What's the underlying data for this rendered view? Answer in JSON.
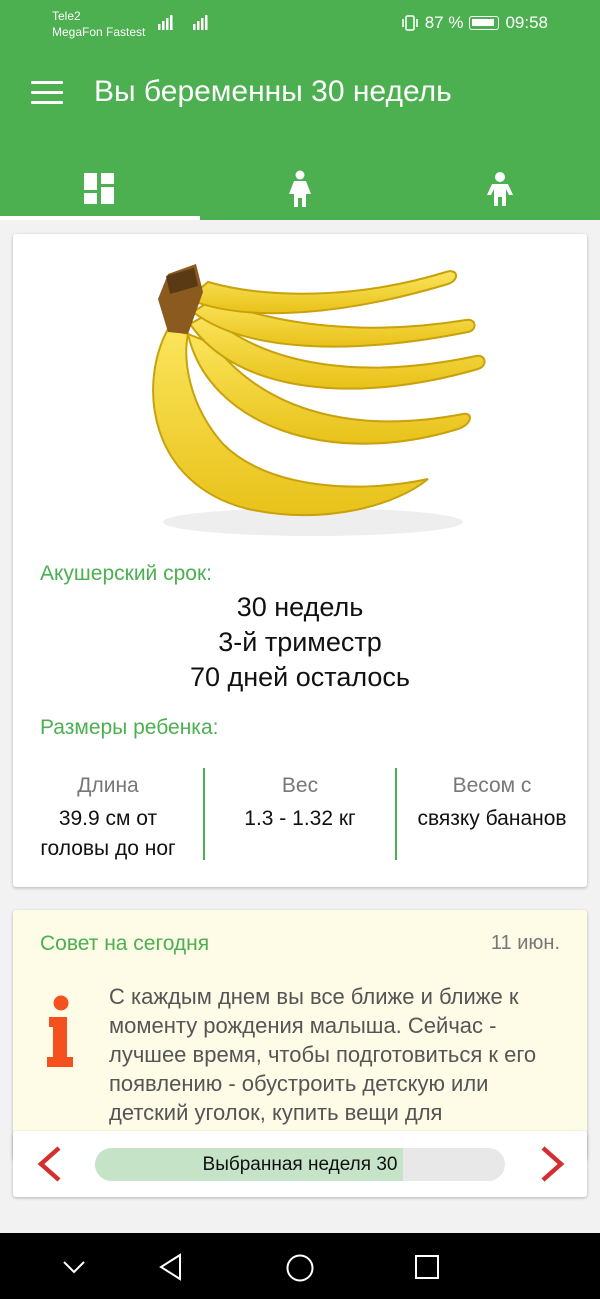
{
  "status_bar": {
    "carrier_1": "Tele2",
    "carrier_2": "MegaFon Fastest",
    "battery": "87 %",
    "time": "09:58"
  },
  "app_bar": {
    "title": "Вы беременны 30 недель",
    "menu_icon": "menu-icon",
    "tabs": [
      {
        "icon": "dashboard-icon",
        "active": true
      },
      {
        "icon": "woman-icon",
        "active": false
      },
      {
        "icon": "child-icon",
        "active": false
      }
    ]
  },
  "info": {
    "image": "banana-bunch",
    "term_label": "Акушерский срок:",
    "term_lines": [
      "30 недель",
      "3-й триместр",
      "70 дней осталось"
    ],
    "size_label": "Размеры ребенка:",
    "sizes": [
      {
        "head": "Длина",
        "value": "39.9 см от головы до ног"
      },
      {
        "head": "Вес",
        "value": "1.3 - 1.32 кг"
      },
      {
        "head": "Весом с",
        "value": "связку бананов"
      }
    ]
  },
  "tip": {
    "title": "Совет на сегодня",
    "date": "11 июн.",
    "text": "С каждым днем вы все ближе и ближе к моменту рождения малыша. Сейчас - лучшее время, чтобы подготовиться к его появлению - обустроить детскую или детский уголок, купить вещи для"
  },
  "week_selector": {
    "label": "Выбранная неделя 30",
    "progress": 0.75
  },
  "colors": {
    "primary": "#4caf50",
    "tip_background": "#fefbe6",
    "arrow": "#d32f2f",
    "info_icon": "#f4511e"
  }
}
